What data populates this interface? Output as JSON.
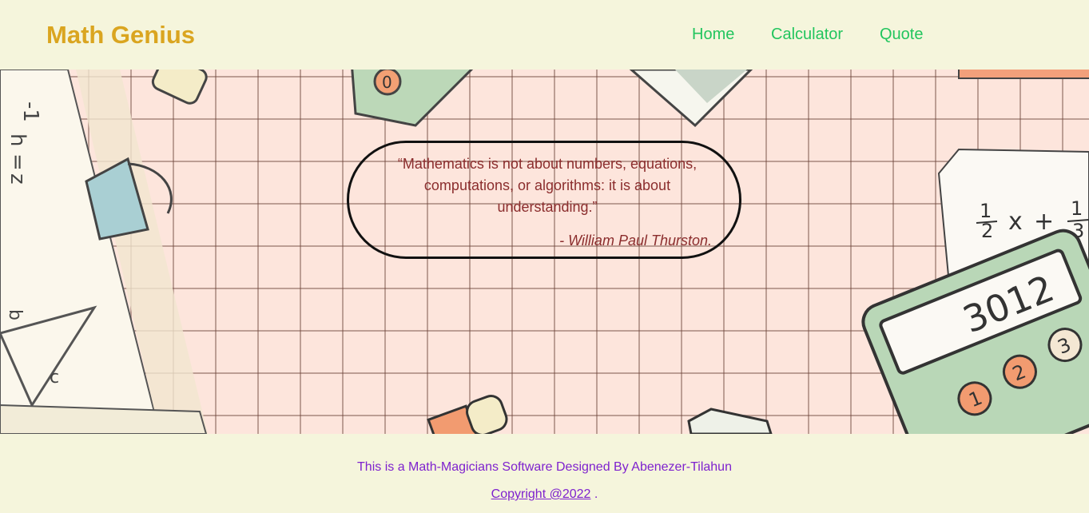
{
  "brand": {
    "title": "Math Genius"
  },
  "nav": {
    "items": [
      "Home",
      "Calculator",
      "Quote"
    ]
  },
  "quote": {
    "text": "“Mathematics is not about numbers, equations, computations, or algorithms: it is about understanding.”",
    "author": "- William Paul Thurston."
  },
  "illustration": {
    "calculator_display": "3012",
    "calculator_keys": [
      "0",
      "1",
      "2",
      "3"
    ],
    "notes_left": [
      "-1",
      "h",
      "=",
      "z"
    ],
    "notes_right_fraction": [
      "1",
      "2",
      "x",
      "+",
      "1",
      "3"
    ],
    "triangle_labels": [
      "b",
      "c"
    ]
  },
  "footer": {
    "credit": "This is a Math-Magicians Software Designed By Abenezer-Tilahun",
    "copyright_link": "Copyright @2022",
    "copyright_suffix": " ."
  },
  "colors": {
    "page_bg": "#f5f5dc",
    "brand": "#daa520",
    "nav_link": "#22c55e",
    "hero_bg": "#fde5dc",
    "quote_text": "#8b2d2d",
    "footer_text": "#7e22ce"
  }
}
